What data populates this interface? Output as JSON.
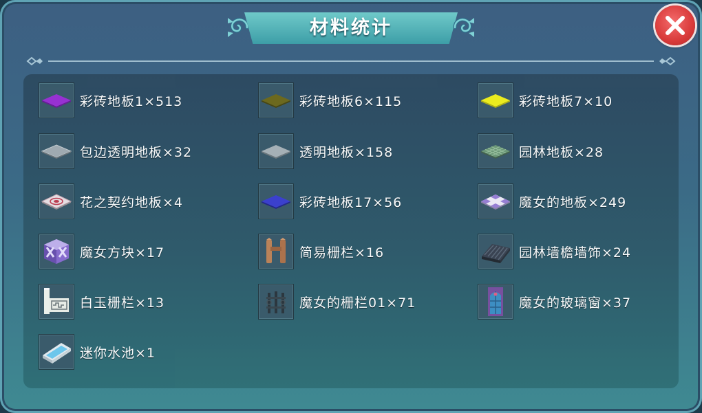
{
  "header": {
    "title": "材料统计"
  },
  "close_button": {
    "icon": "close-icon"
  },
  "colors": {
    "banner": "#4fb3b6",
    "close_red": "#d93a3a",
    "panel": "#2d4a61"
  },
  "materials": [
    {
      "label": "彩砖地板1×513",
      "icon": "purple-floor-tile-icon",
      "color": "#9b2fd6"
    },
    {
      "label": "彩砖地板6×115",
      "icon": "olive-floor-tile-icon",
      "color": "#6e6a1a"
    },
    {
      "label": "彩砖地板7×10",
      "icon": "yellow-floor-tile-icon",
      "color": "#f3f21a"
    },
    {
      "label": "包边透明地板×32",
      "icon": "bordered-transparent-floor-icon",
      "color": "#9aa6ad"
    },
    {
      "label": "透明地板×158",
      "icon": "transparent-floor-icon",
      "color": "#9aa6ad"
    },
    {
      "label": "园林地板×28",
      "icon": "garden-floor-icon",
      "color": "#5f8a6a"
    },
    {
      "label": "花之契约地板×4",
      "icon": "flower-pact-floor-icon",
      "color": "#e6d7de"
    },
    {
      "label": "彩砖地板17×56",
      "icon": "blue-floor-tile-icon",
      "color": "#3b3fd0"
    },
    {
      "label": "魔女的地板×249",
      "icon": "witch-floor-icon",
      "color": "#c9b9e8"
    },
    {
      "label": "魔女方块×17",
      "icon": "witch-block-icon",
      "color": "#7d5fb8"
    },
    {
      "label": "简易栅栏×16",
      "icon": "simple-fence-icon",
      "color": "#b0724a"
    },
    {
      "label": "园林墙檐墙饰×24",
      "icon": "garden-wall-eave-icon",
      "color": "#3a4250"
    },
    {
      "label": "白玉栅栏×13",
      "icon": "white-jade-fence-icon",
      "color": "#eef0ea"
    },
    {
      "label": "魔女的栅栏01×71",
      "icon": "witch-fence-icon",
      "color": "#3e4a52"
    },
    {
      "label": "魔女的玻璃窗×37",
      "icon": "witch-glass-window-icon",
      "color": "#3d8fc6"
    },
    {
      "label": "迷你水池×1",
      "icon": "mini-pool-icon",
      "color": "#7fd0f0"
    }
  ]
}
